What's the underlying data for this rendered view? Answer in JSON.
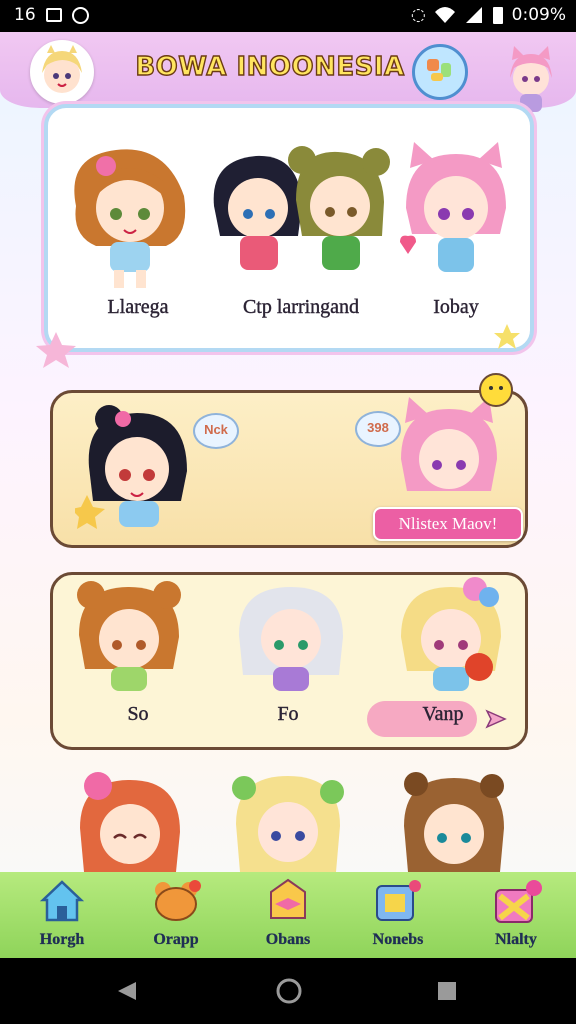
{
  "status_bar": {
    "left_time": "16",
    "right_time": "0:09%"
  },
  "header": {
    "title": "BOWA INOONESIA"
  },
  "featured_card": {
    "characters": [
      {
        "name": "Llarega"
      },
      {
        "name": "Ctp larringand"
      },
      {
        "name": "Iobay"
      }
    ]
  },
  "promo_card": {
    "bubble_left": "Nck",
    "bubble_right": "398",
    "button_label": "Nlistex Maov!"
  },
  "group_card": {
    "characters": [
      {
        "name": "So"
      },
      {
        "name": "Fo"
      },
      {
        "name": "Vanp"
      }
    ]
  },
  "bottom_nav": {
    "items": [
      {
        "label": "Horgh",
        "icon": "house-icon"
      },
      {
        "label": "Orapp",
        "icon": "bear-icon"
      },
      {
        "label": "Obans",
        "icon": "bow-icon"
      },
      {
        "label": "Nonebs",
        "icon": "gallery-icon"
      },
      {
        "label": "Nlalty",
        "icon": "gift-icon"
      }
    ]
  },
  "colors": {
    "accent": "#ec5fa4",
    "nav": "#9fdd66",
    "header": "#e9bff0",
    "card_border": "#6b4a35"
  }
}
